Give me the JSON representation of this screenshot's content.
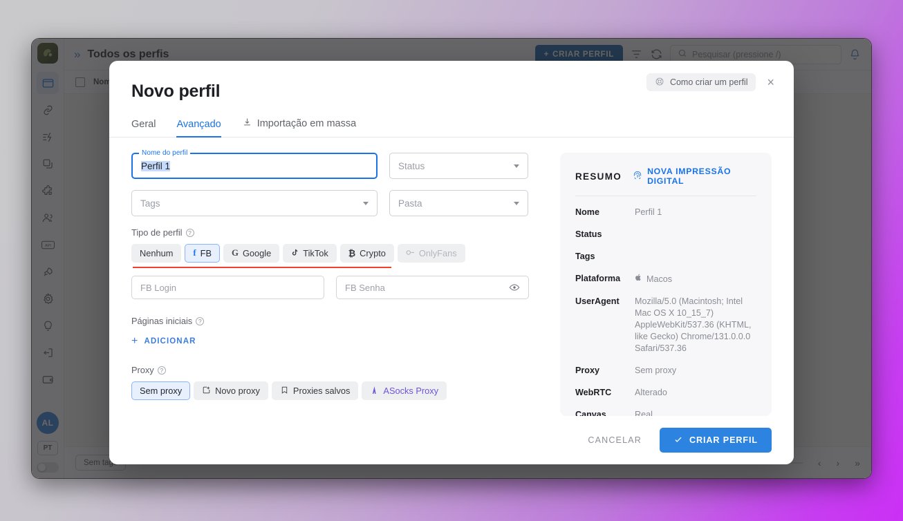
{
  "app": {
    "title": "Todos os perfis",
    "expand_icon": "chevrons-right-icon",
    "create_profile_label": "CRIAR PERFIL",
    "filter_icon": "filter-icon",
    "refresh_icon": "refresh-icon",
    "search_placeholder": "Pesquisar (pressione /)",
    "notification_icon": "bell-icon",
    "table_col_name": "Nom",
    "footer_tag": "Sem tags",
    "sidebar": {
      "logo": "app-logo",
      "items": [
        {
          "name": "profiles",
          "icon": "browser-window-icon",
          "active": true
        },
        {
          "name": "links",
          "icon": "link-icon",
          "active": false
        },
        {
          "name": "automation",
          "icon": "automation-icon",
          "active": false
        },
        {
          "name": "copies",
          "icon": "copy-icon",
          "active": false
        },
        {
          "name": "extensions",
          "icon": "puzzle-icon",
          "active": false
        },
        {
          "name": "team",
          "icon": "users-icon",
          "active": false
        },
        {
          "name": "api",
          "icon": "api-icon",
          "active": false
        },
        {
          "name": "launch",
          "icon": "rocket-icon",
          "active": false
        },
        {
          "name": "settings",
          "icon": "gear-icon",
          "active": false
        },
        {
          "name": "tips",
          "icon": "lightbulb-icon",
          "active": false
        },
        {
          "name": "logout",
          "icon": "logout-icon",
          "active": false
        },
        {
          "name": "billing",
          "icon": "wallet-icon",
          "active": false
        }
      ],
      "avatar_initials": "AL",
      "language": "PT",
      "theme_toggle": "theme-toggle"
    },
    "pager": {
      "prev": "‹",
      "next": "›",
      "last": "»"
    }
  },
  "dialog": {
    "title": "Novo perfil",
    "help_chip": "Como criar um perfil",
    "help_icon": "lifebuoy-icon",
    "close_icon": "close-icon",
    "tabs": [
      {
        "label": "Geral",
        "active": false,
        "icon": null
      },
      {
        "label": "Avançado",
        "active": true,
        "icon": null
      },
      {
        "label": "Importação em massa",
        "active": false,
        "icon": "download-icon"
      }
    ],
    "fields": {
      "profile_name_legend": "Nome do perfil",
      "profile_name_value": "Perfil 1",
      "status_placeholder": "Status",
      "tags_placeholder": "Tags",
      "folder_placeholder": "Pasta"
    },
    "profile_type": {
      "label": "Tipo de perfil",
      "help_icon": "question-icon",
      "options": [
        {
          "label": "Nenhum",
          "icon": null,
          "state": "normal"
        },
        {
          "label": "FB",
          "icon": "facebook-icon",
          "state": "selected"
        },
        {
          "label": "Google",
          "icon": "google-icon",
          "state": "normal"
        },
        {
          "label": "TikTok",
          "icon": "tiktok-icon",
          "state": "normal"
        },
        {
          "label": "Crypto",
          "icon": "bitcoin-icon",
          "state": "normal"
        },
        {
          "label": "OnlyFans",
          "icon": "onlyfans-icon",
          "state": "disabled"
        }
      ],
      "login_placeholder": "FB Login",
      "password_placeholder": "FB Senha",
      "eye_icon": "eye-icon",
      "error_underline_color": "#f0402f"
    },
    "start_pages": {
      "label": "Páginas iniciais",
      "help_icon": "question-icon",
      "add_label": "ADICIONAR",
      "add_icon": "plus-icon"
    },
    "proxy": {
      "label": "Proxy",
      "help_icon": "question-icon",
      "options": [
        {
          "label": "Sem proxy",
          "icon": null,
          "state": "selected"
        },
        {
          "label": "Novo proxy",
          "icon": "new-proxy-icon",
          "state": "normal"
        },
        {
          "label": "Proxies salvos",
          "icon": "bookmark-icon",
          "state": "normal"
        },
        {
          "label": "ASocks Proxy",
          "icon": "asocks-icon",
          "state": "violet"
        }
      ]
    },
    "summary": {
      "title": "RESUMO",
      "fingerprint_label": "NOVA IMPRESSÃO DIGITAL",
      "fingerprint_icon": "fingerprint-icon",
      "rows": [
        {
          "key": "Nome",
          "value": "Perfil 1",
          "icon": null
        },
        {
          "key": "Status",
          "value": "",
          "icon": null
        },
        {
          "key": "Tags",
          "value": "",
          "icon": null
        },
        {
          "key": "Plataforma",
          "value": "Macos",
          "icon": "apple-icon"
        },
        {
          "key": "UserAgent",
          "value": "Mozilla/5.0 (Macintosh; Intel Mac OS X 10_15_7) AppleWebKit/537.36 (KHTML, like Gecko) Chrome/131.0.0.0 Safari/537.36",
          "icon": null
        },
        {
          "key": "Proxy",
          "value": "Sem proxy",
          "icon": null
        },
        {
          "key": "WebRTC",
          "value": "Alterado",
          "icon": null
        },
        {
          "key": "Canvas",
          "value": "Real",
          "icon": null
        }
      ]
    },
    "footer": {
      "cancel_label": "CANCELAR",
      "create_label": "CRIAR PERFIL",
      "create_icon": "check-icon",
      "accent_color": "#2c84e0"
    }
  }
}
